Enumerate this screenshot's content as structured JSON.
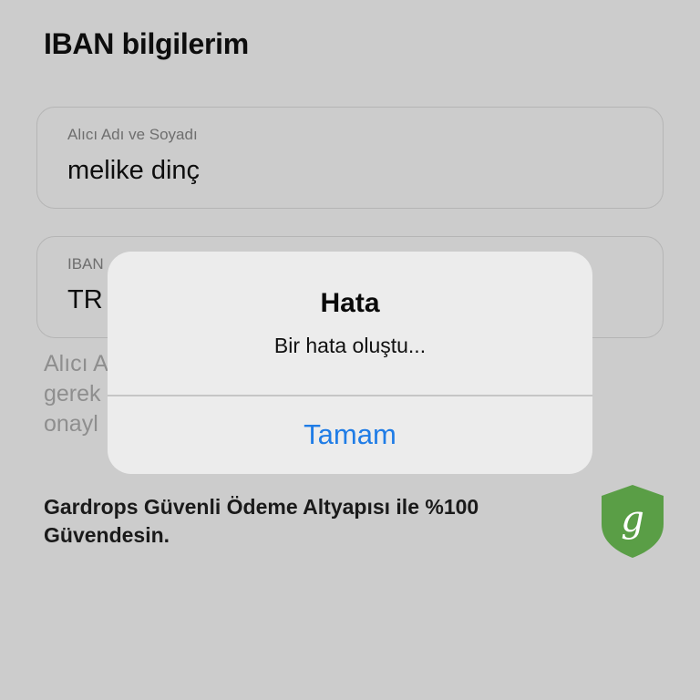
{
  "header": {
    "title": "IBAN bilgilerim"
  },
  "form": {
    "name_field": {
      "label": "Alıcı Adı ve Soyadı",
      "value": "melike dinç"
    },
    "iban_field": {
      "label": "IBAN",
      "value": "TR"
    }
  },
  "info": {
    "lines": [
      "Alıcı A",
      "gerek",
      "onayl"
    ]
  },
  "security": {
    "text": "Gardrops Güvenli Ödeme Altyapısı ile %100 Güvendesin.",
    "badge_letter": "g",
    "badge_color": "#5a9e46"
  },
  "alert": {
    "title": "Hata",
    "message": "Bir hata oluştu...",
    "button_label": "Tamam",
    "button_color": "#1f7ce6"
  }
}
